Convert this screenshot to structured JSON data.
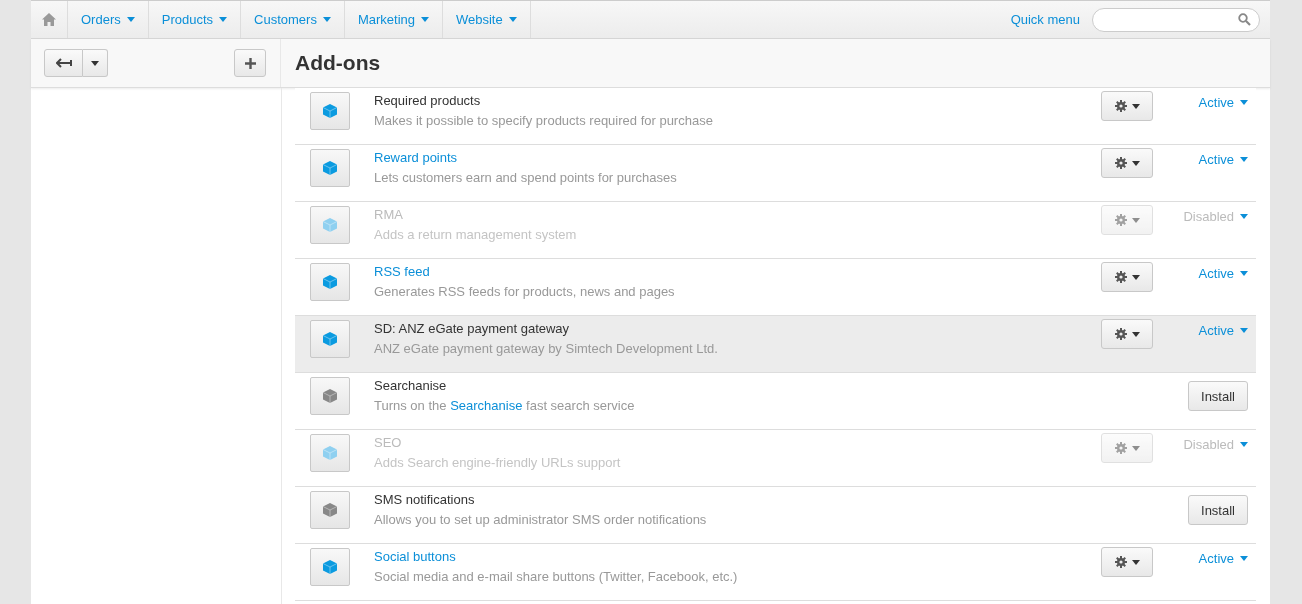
{
  "nav": {
    "items": [
      {
        "label": "Orders"
      },
      {
        "label": "Products"
      },
      {
        "label": "Customers"
      },
      {
        "label": "Marketing"
      },
      {
        "label": "Website"
      }
    ],
    "quick_menu": "Quick menu"
  },
  "page_title": "Add-ons",
  "addons": [
    {
      "kind": "installed",
      "name": "Required products",
      "link": false,
      "disabled": false,
      "highlighted": false,
      "description": [
        {
          "text": "Makes it possible to specify products required for purchase",
          "link": false
        }
      ],
      "status": "Active"
    },
    {
      "kind": "installed",
      "name": "Reward points",
      "link": true,
      "disabled": false,
      "highlighted": false,
      "description": [
        {
          "text": "Lets customers earn and spend points for purchases",
          "link": false
        }
      ],
      "status": "Active"
    },
    {
      "kind": "installed",
      "name": "RMA",
      "link": false,
      "disabled": true,
      "highlighted": false,
      "description": [
        {
          "text": "Adds a return management system",
          "link": false
        }
      ],
      "status": "Disabled"
    },
    {
      "kind": "installed",
      "name": "RSS feed",
      "link": true,
      "disabled": false,
      "highlighted": false,
      "description": [
        {
          "text": "Generates RSS feeds for products, news and pages",
          "link": false
        }
      ],
      "status": "Active"
    },
    {
      "kind": "installed",
      "name": "SD: ANZ eGate payment gateway",
      "link": false,
      "disabled": false,
      "highlighted": true,
      "description": [
        {
          "text": "ANZ eGate payment gateway by Simtech Development Ltd.",
          "link": false
        }
      ],
      "status": "Active"
    },
    {
      "kind": "available",
      "name": "Searchanise",
      "link": false,
      "disabled": false,
      "highlighted": false,
      "description": [
        {
          "text": "Turns on the",
          "link": false
        },
        {
          "text": "Searchanise",
          "link": true
        },
        {
          "text": "fast search service",
          "link": false
        }
      ],
      "button": "Install"
    },
    {
      "kind": "installed",
      "name": "SEO",
      "link": false,
      "disabled": true,
      "highlighted": false,
      "description": [
        {
          "text": "Adds Search engine-friendly URLs support",
          "link": false
        }
      ],
      "status": "Disabled"
    },
    {
      "kind": "available",
      "name": "SMS notifications",
      "link": false,
      "disabled": false,
      "highlighted": false,
      "description": [
        {
          "text": "Allows you to set up administrator SMS order notifications",
          "link": false
        }
      ],
      "button": "Install"
    },
    {
      "kind": "installed",
      "name": "Social buttons",
      "link": true,
      "disabled": false,
      "highlighted": false,
      "description": [
        {
          "text": "Social media and e-mail share buttons (Twitter, Facebook, etc.)",
          "link": false
        }
      ],
      "status": "Active"
    }
  ]
}
